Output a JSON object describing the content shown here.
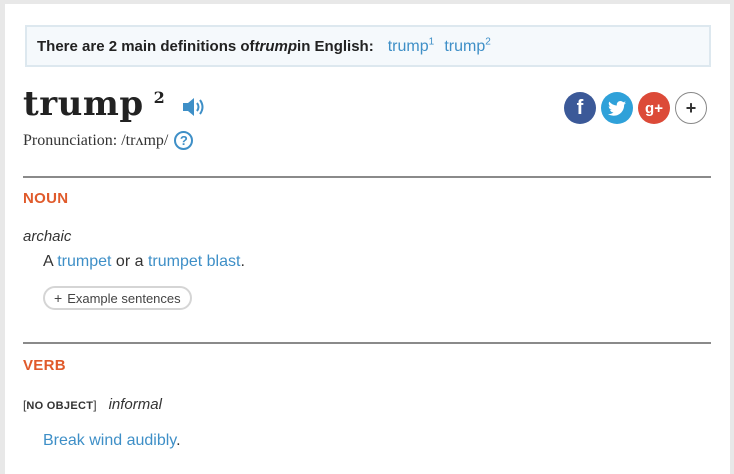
{
  "banner": {
    "text_before": "There are 2 main definitions of ",
    "word": "trump",
    "text_after": " in English:",
    "links": [
      {
        "label": "trump",
        "sup": "1"
      },
      {
        "label": "trump",
        "sup": "2"
      }
    ]
  },
  "entry": {
    "headword": "trump",
    "homograph": "2",
    "pronunciation_label": "Pronunciation:",
    "pronunciation": "/trʌmp/",
    "help_symbol": "?"
  },
  "share": {
    "facebook": "f",
    "googleplus": "g+",
    "more": "+"
  },
  "senses": [
    {
      "pos": "NOUN",
      "register": "archaic",
      "definition": {
        "t1": "A ",
        "link1": "trumpet",
        "t2": " or a ",
        "link2": "trumpet blast",
        "t3": "."
      },
      "example_button": "Example sentences",
      "example_plus": "+"
    },
    {
      "pos": "VERB",
      "grammar": "NO OBJECT",
      "register": "informal",
      "definition": {
        "link1": "Break wind audibly",
        "t1": "."
      }
    }
  ],
  "colors": {
    "link": "#3e8fc7",
    "pos": "#e05a2b",
    "facebook": "#3b5998",
    "twitter": "#2fa1d9",
    "googleplus": "#dc4a38"
  },
  "icons": [
    "speaker-icon",
    "help-icon",
    "facebook-icon",
    "twitter-icon",
    "googleplus-icon",
    "more-share-icon"
  ]
}
